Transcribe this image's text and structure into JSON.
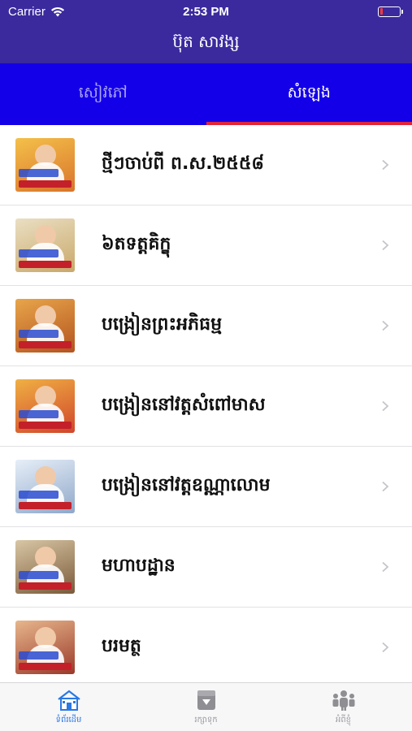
{
  "status": {
    "carrier": "Carrier",
    "time": "2:53 PM",
    "battery_level": 0.15,
    "battery_color": "#ff3b30"
  },
  "header": {
    "title": "ប៊ុត សាវង្ស"
  },
  "tabs": [
    {
      "label": "សៀវភៅ",
      "active": false
    },
    {
      "label": "សំឡេង",
      "active": true
    }
  ],
  "colors": {
    "nav": "#3a2a9e",
    "tabs": "#1400e8",
    "tab_indicator": "#e0243c",
    "tabbar_active": "#2a78e4"
  },
  "list": {
    "items": [
      {
        "label": "ថ្មីៗចាប់ពី ព.ស.២៥៥៨",
        "thumb_colors": [
          "#d9742b",
          "#f4c04a"
        ]
      },
      {
        "label": "៦តទត្តគិក្ខុ",
        "thumb_colors": [
          "#c9a86a",
          "#eadfc3"
        ]
      },
      {
        "label": "បង្រៀនព្រះអភិធម្ម",
        "thumb_colors": [
          "#b3541f",
          "#e8a54a"
        ]
      },
      {
        "label": "បង្រៀននៅវត្តសំពៅមាស",
        "thumb_colors": [
          "#d0462a",
          "#f0b044"
        ]
      },
      {
        "label": "បង្រៀននៅវត្តឧណ្ណាលោម",
        "thumb_colors": [
          "#8fa8c9",
          "#e6eef8"
        ]
      },
      {
        "label": "មហាបដ្ឋាន",
        "thumb_colors": [
          "#7a5a3a",
          "#d8c6a4"
        ]
      },
      {
        "label": "បរមត្ថ",
        "thumb_colors": [
          "#9a3a2a",
          "#e7b68c"
        ]
      }
    ]
  },
  "tabbar": {
    "items": [
      {
        "label": "ទំព័រដើម",
        "icon": "home-icon",
        "active": true
      },
      {
        "label": "រក្សាទុក",
        "icon": "download-icon",
        "active": false
      },
      {
        "label": "អំពីខ្ញុំ",
        "icon": "people-icon",
        "active": false
      }
    ]
  }
}
